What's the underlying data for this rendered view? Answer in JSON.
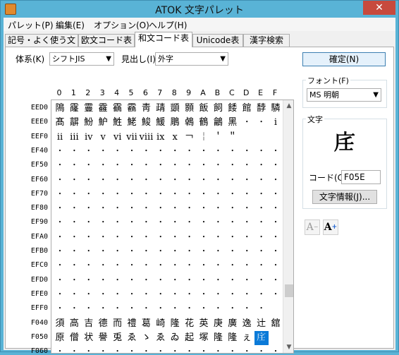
{
  "window": {
    "title": "ATOK 文字パレット",
    "close": "✕"
  },
  "menu": [
    "パレット(P)",
    "編集(E)",
    "オプション(O)",
    "ヘルプ(H)"
  ],
  "tabs": [
    "記号・よく使う文字",
    "欧文コード表",
    "和文コード表",
    "Unicode表",
    "漢字検索"
  ],
  "active_tab": 2,
  "controls": {
    "system_label": "体系(K)",
    "system_value": "シフトJIS",
    "heading_label": "見出し(I)",
    "heading_value": "外字",
    "confirm_button": "確定(N)",
    "font_label": "フォント(F)",
    "font_value": "MS 明朝",
    "char_label": "文字",
    "code_label": "コード(C)",
    "code_value": "F05E",
    "char_info_button": "文字情報(J)...",
    "selected_char": "𢇦"
  },
  "grid": {
    "columns": [
      "0",
      "1",
      "2",
      "3",
      "4",
      "5",
      "6",
      "7",
      "8",
      "9",
      "A",
      "B",
      "C",
      "D",
      "E",
      "F"
    ],
    "rows": [
      {
        "label": "EED0",
        "chars": [
          "隝",
          "霳",
          "霻",
          "靃",
          "靍",
          "靏",
          "靑",
          "靕",
          "顗",
          "顥",
          "飯",
          "飼",
          "餧",
          "館",
          "馞",
          "驎"
        ]
      },
      {
        "label": "EEE0",
        "chars": [
          "髙",
          "髜",
          "魵",
          "魲",
          "鮏",
          "鮱",
          "鮻",
          "鰀",
          "鵰",
          "鵫",
          "鶴",
          "鸙",
          "黑",
          "･",
          "･",
          "ⅰ"
        ]
      },
      {
        "label": "EEF0",
        "chars": [
          "ⅱ",
          "ⅲ",
          "ⅳ",
          "ⅴ",
          "ⅵ",
          "ⅶ",
          "ⅷ",
          "ⅸ",
          "ⅹ",
          "￢",
          "￤",
          "＇",
          "＂",
          "",
          "",
          ""
        ]
      },
      {
        "label": "EF40",
        "chars": [
          "･",
          "･",
          "･",
          "･",
          "･",
          "･",
          "･",
          "･",
          "･",
          "･",
          "･",
          "･",
          "･",
          "･",
          "･",
          "･"
        ]
      },
      {
        "label": "EF50",
        "chars": [
          "･",
          "･",
          "･",
          "･",
          "･",
          "･",
          "･",
          "･",
          "･",
          "･",
          "･",
          "･",
          "･",
          "･",
          "･",
          "･"
        ]
      },
      {
        "label": "EF60",
        "chars": [
          "･",
          "･",
          "･",
          "･",
          "･",
          "･",
          "･",
          "･",
          "･",
          "･",
          "･",
          "･",
          "･",
          "･",
          "･",
          "･"
        ]
      },
      {
        "label": "EF70",
        "chars": [
          "･",
          "･",
          "･",
          "･",
          "･",
          "･",
          "･",
          "･",
          "･",
          "･",
          "･",
          "･",
          "･",
          "･",
          "･",
          "･"
        ]
      },
      {
        "label": "EF80",
        "chars": [
          "･",
          "･",
          "･",
          "･",
          "･",
          "･",
          "･",
          "･",
          "･",
          "･",
          "･",
          "･",
          "･",
          "･",
          "･",
          "･"
        ]
      },
      {
        "label": "EF90",
        "chars": [
          "･",
          "･",
          "･",
          "･",
          "･",
          "･",
          "･",
          "･",
          "･",
          "･",
          "･",
          "･",
          "･",
          "･",
          "･",
          "･"
        ]
      },
      {
        "label": "EFA0",
        "chars": [
          "･",
          "･",
          "･",
          "･",
          "･",
          "･",
          "･",
          "･",
          "･",
          "･",
          "･",
          "･",
          "･",
          "･",
          "･",
          "･"
        ]
      },
      {
        "label": "EFB0",
        "chars": [
          "･",
          "･",
          "･",
          "･",
          "･",
          "･",
          "･",
          "･",
          "･",
          "･",
          "･",
          "･",
          "･",
          "･",
          "･",
          "･"
        ]
      },
      {
        "label": "EFC0",
        "chars": [
          "･",
          "･",
          "･",
          "･",
          "･",
          "･",
          "･",
          "･",
          "･",
          "･",
          "･",
          "･",
          "･",
          "･",
          "･",
          "･"
        ]
      },
      {
        "label": "EFD0",
        "chars": [
          "･",
          "･",
          "･",
          "･",
          "･",
          "･",
          "･",
          "･",
          "･",
          "･",
          "･",
          "･",
          "･",
          "･",
          "･",
          "･"
        ]
      },
      {
        "label": "EFE0",
        "chars": [
          "･",
          "･",
          "･",
          "･",
          "･",
          "･",
          "･",
          "･",
          "･",
          "･",
          "･",
          "･",
          "･",
          "･",
          "･",
          "･"
        ]
      },
      {
        "label": "EFF0",
        "chars": [
          "･",
          "･",
          "･",
          "･",
          "･",
          "･",
          "･",
          "･",
          "･",
          "･",
          "･",
          "･",
          "･",
          "･",
          "･",
          ""
        ]
      },
      {
        "label": "F040",
        "chars": [
          "須",
          "高",
          "吉",
          "德",
          "而",
          "禮",
          "葛",
          "崎",
          "隆",
          "花",
          "英",
          "庚",
          "廣",
          "逸",
          "辻",
          "舘"
        ]
      },
      {
        "label": "F050",
        "chars": [
          "原",
          "僧",
          "状",
          "譽",
          "兎",
          "ゑ",
          "ゝ",
          "ゑ",
          "ゐ",
          "起",
          "塚",
          "隆",
          "隆",
          "ぇ",
          "𢇦",
          ""
        ]
      },
      {
        "label": "F060",
        "chars": [
          "･",
          "･",
          "･",
          "･",
          "･",
          "･",
          "･",
          "･",
          "･",
          "･",
          "･",
          "･",
          "･",
          "･",
          "･",
          "･"
        ]
      }
    ],
    "selected": {
      "row": 16,
      "col": 14
    }
  }
}
